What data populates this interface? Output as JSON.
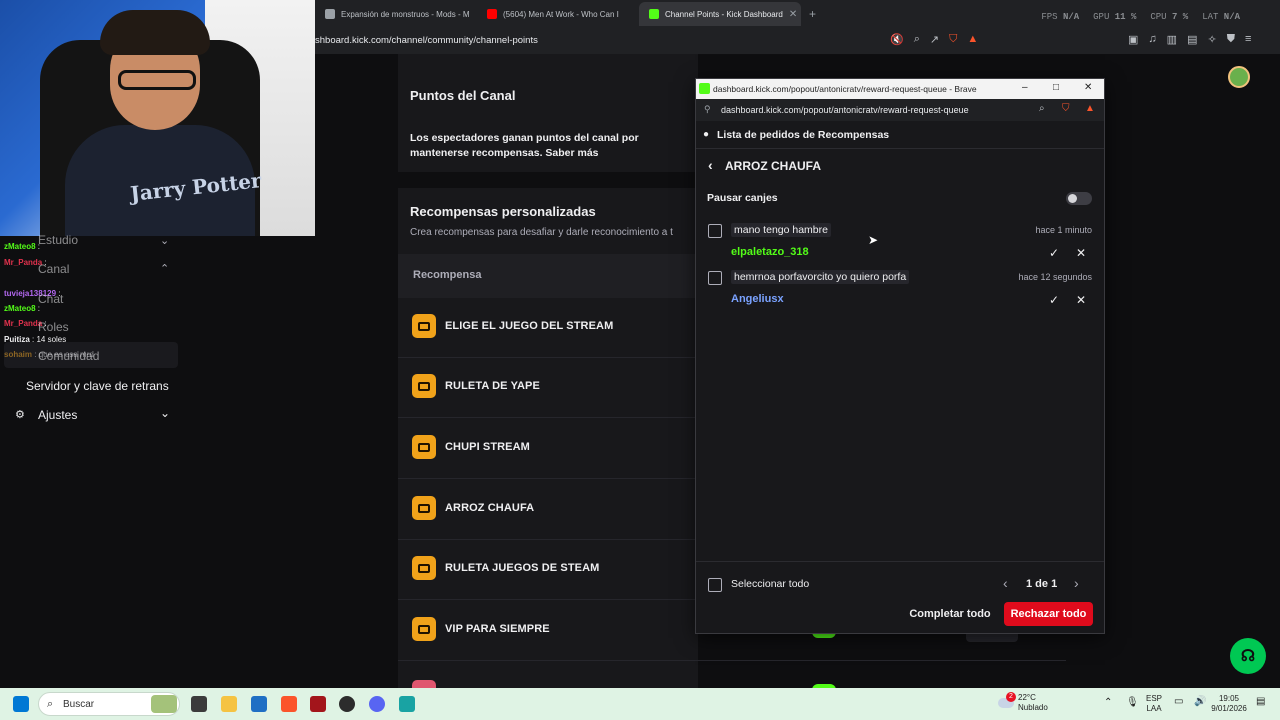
{
  "browser": {
    "tabs": [
      {
        "title": "Expansión de monstruos - Mods - M",
        "favicon_color": "#9aa0a6"
      },
      {
        "title": "(5604) Men At Work - Who Can I",
        "favicon_color": "#ff0000"
      },
      {
        "title": "Channel Points - Kick Dashboard",
        "favicon_color": "#53fc18"
      }
    ],
    "new_tab": "+",
    "hud": {
      "fps_label": "FPS",
      "fps_value": "N/A",
      "gpu_label": "GPU",
      "gpu_value": "11 %",
      "cpu_label": "CPU",
      "cpu_value": "7 %",
      "lat_label": "LAT",
      "lat_value": "N/A"
    },
    "url": "shboard.kick.com/channel/community/channel-points"
  },
  "stream_overlay": {
    "shirt_print": "Jarry Potter",
    "chat": [
      {
        "user": "zMateo8",
        "msg": ":",
        "color": "#53fc18"
      },
      {
        "user": "Mr_Panda",
        "msg": ":",
        "color": "#e0324d"
      },
      {
        "user": "tuvieja138129",
        "msg": ":",
        "color": "#b368f0"
      },
      {
        "user": "zMateo8",
        "msg": ":",
        "color": "#53fc18"
      },
      {
        "user": "Mr_Panda",
        "msg": ":",
        "color": "#e0324d"
      },
      {
        "user": "Puitiza",
        "msg": ": 14 soles",
        "color": "#efeff1"
      },
      {
        "user": "sohaim",
        "msg": ": que es esa mrd",
        "color": "#f0a21a"
      }
    ]
  },
  "sidebar": {
    "items": [
      {
        "label": "Estudio"
      },
      {
        "label": "Canal"
      },
      {
        "label": "Chat"
      },
      {
        "label": "Roles"
      },
      {
        "label": "Comunidad"
      },
      {
        "label": "Servidor y clave de retrans"
      },
      {
        "label": "Ajustes"
      }
    ]
  },
  "main": {
    "section_title": "Puntos del Canal",
    "description": "Los espectadores ganan puntos del canal por mantenerse recompensas. Saber más",
    "custom_title": "Recompensas personalizadas",
    "custom_subtitle": "Crea recompensas para desafiar y darle reconocimiento a t",
    "column_reward": "Recompensa",
    "rewards": [
      {
        "name": "ELIGE EL JUEGO DEL STREAM"
      },
      {
        "name": "RULETA DE YAPE"
      },
      {
        "name": "CHUPI STREAM"
      },
      {
        "name": "ARROZ CHAUFA"
      },
      {
        "name": "RULETA JUEGOS DE STEAM"
      },
      {
        "name": "VIP PARA SIEMPRE"
      }
    ]
  },
  "popup": {
    "window_title": "dashboard.kick.com/popout/antonicratv/reward-request-queue - Brave",
    "url": "dashboard.kick.com/popout/antonicratv/reward-request-queue",
    "header": "Lista de pedidos de Recompensas",
    "reward_name": "ARROZ CHAUFA",
    "pause_label": "Pausar canjes",
    "requests": [
      {
        "text": "mano tengo hambre",
        "time": "hace 1 minuto",
        "user": "elpaletazo_318",
        "user_color": "#53fc18"
      },
      {
        "text": "hemrnoa porfavorcito yo quiero porfa",
        "time": "hace 12 segundos",
        "user": "Angeliusx",
        "user_color": "#7aa2ff"
      }
    ],
    "select_all": "Seleccionar todo",
    "pagination": "1 de 1",
    "complete_all": "Completar todo",
    "reject_all": "Rechazar todo"
  },
  "taskbar": {
    "search_placeholder": "Buscar",
    "weather_temp": "22°C",
    "weather_desc": "Nublado",
    "weather_badge": "2",
    "lang_top": "ESP",
    "lang_bottom": "LAA",
    "time": "19:05",
    "date": "9/01/2026"
  },
  "colors": {
    "kick_green": "#53fc18",
    "reject_red": "#e00b1c",
    "reward_orange": "#f0a21a"
  }
}
